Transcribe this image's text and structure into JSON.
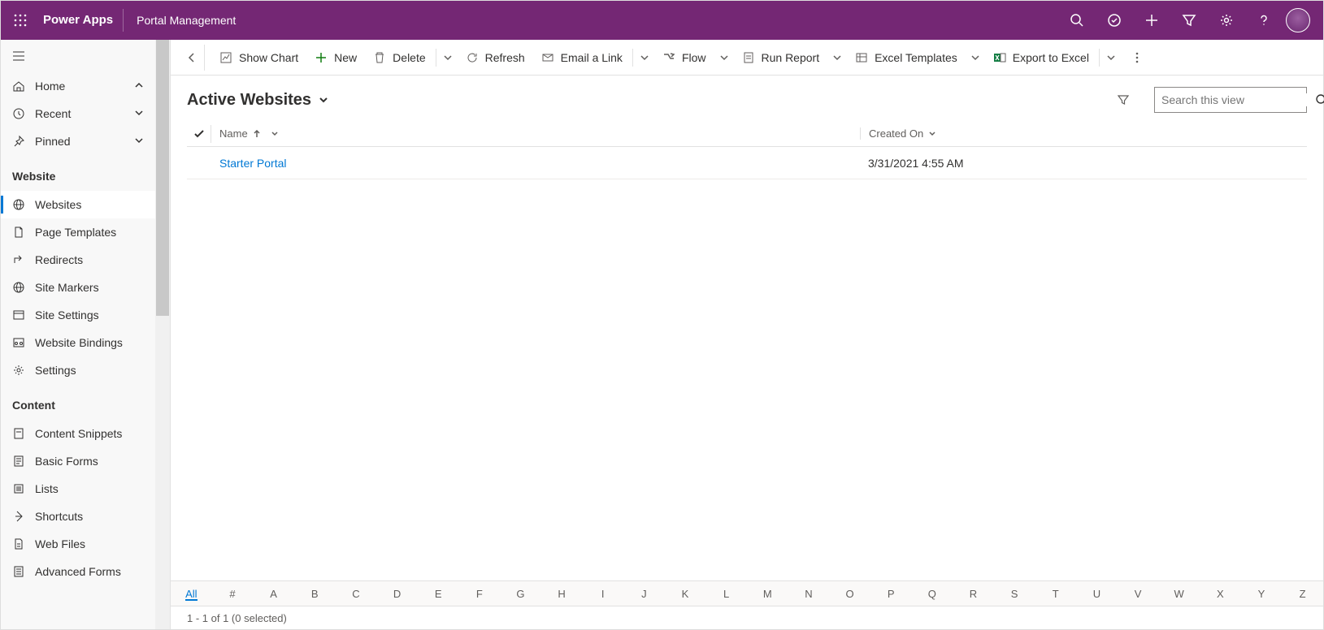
{
  "header": {
    "app_name": "Power Apps",
    "app_sub": "Portal Management"
  },
  "sidebar": {
    "home": "Home",
    "recent": "Recent",
    "pinned": "Pinned",
    "group_website": "Website",
    "items_website": {
      "websites": "Websites",
      "page_templates": "Page Templates",
      "redirects": "Redirects",
      "site_markers": "Site Markers",
      "site_settings": "Site Settings",
      "website_bindings": "Website Bindings",
      "settings": "Settings"
    },
    "group_content": "Content",
    "items_content": {
      "content_snippets": "Content Snippets",
      "basic_forms": "Basic Forms",
      "lists": "Lists",
      "shortcuts": "Shortcuts",
      "web_files": "Web Files",
      "advanced_forms": "Advanced Forms"
    }
  },
  "commands": {
    "show_chart": "Show Chart",
    "new": "New",
    "delete": "Delete",
    "refresh": "Refresh",
    "email_link": "Email a Link",
    "flow": "Flow",
    "run_report": "Run Report",
    "excel_templates": "Excel Templates",
    "export_excel": "Export to Excel"
  },
  "view": {
    "title": "Active Websites",
    "search_placeholder": "Search this view"
  },
  "grid": {
    "col_name": "Name",
    "col_created": "Created On",
    "rows": [
      {
        "name": "Starter Portal",
        "created": "3/31/2021 4:55 AM"
      }
    ]
  },
  "alpha": {
    "all": "All",
    "hash": "#",
    "letters": [
      "A",
      "B",
      "C",
      "D",
      "E",
      "F",
      "G",
      "H",
      "I",
      "J",
      "K",
      "L",
      "M",
      "N",
      "O",
      "P",
      "Q",
      "R",
      "S",
      "T",
      "U",
      "V",
      "W",
      "X",
      "Y",
      "Z"
    ]
  },
  "status": "1 - 1 of 1 (0 selected)"
}
